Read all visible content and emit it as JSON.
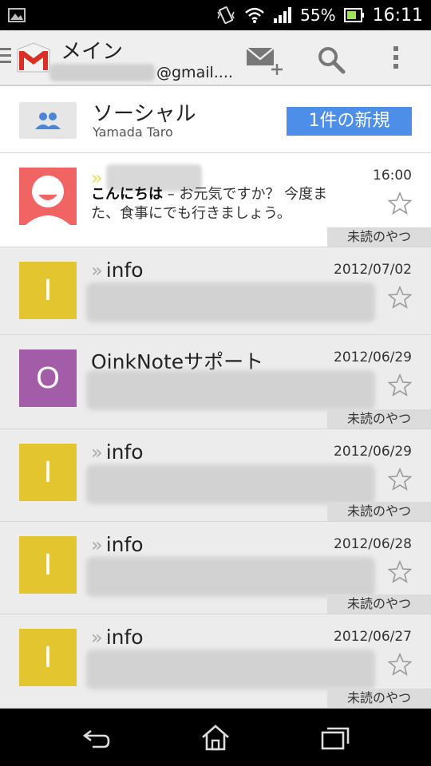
{
  "status_bar": {
    "battery_pct": "55%",
    "clock": "16:11",
    "icons": [
      "image-icon",
      "vibrate-icon",
      "wifi-icon",
      "signal-icon",
      "battery-icon"
    ]
  },
  "action_bar": {
    "title": "メイン",
    "account_suffix": "@gmail....",
    "icons": [
      "menu-icon",
      "gmail-logo",
      "compose-icon",
      "search-icon",
      "overflow-icon"
    ]
  },
  "social": {
    "title": "ソーシャル",
    "subtitle": "Yamada Taro",
    "badge": "1件の新規",
    "icon": "people-icon"
  },
  "emails": [
    {
      "avatar_letter": "",
      "avatar_color": "#f06464",
      "avatar_icon": "person-icon",
      "sender": "",
      "date": "16:00",
      "subject": "こんにちは",
      "snippet": " – お元気ですか？ 今度また、食事にでも行きましょう。",
      "label": "未読のやつ",
      "important": true
    },
    {
      "avatar_letter": "I",
      "avatar_color": "#e3c52f",
      "sender": "info",
      "date": "2012/07/02",
      "label": "",
      "important": false
    },
    {
      "avatar_letter": "O",
      "avatar_color": "#a35ca8",
      "sender": "OinkNoteサポート",
      "date": "2012/06/29",
      "label": "未読のやつ",
      "important": false
    },
    {
      "avatar_letter": "I",
      "avatar_color": "#e3c52f",
      "sender": "info",
      "date": "2012/06/29",
      "label": "未読のやつ",
      "important": false
    },
    {
      "avatar_letter": "I",
      "avatar_color": "#e3c52f",
      "sender": "info",
      "date": "2012/06/28",
      "label": "未読のやつ",
      "important": false
    },
    {
      "avatar_letter": "I",
      "avatar_color": "#e3c52f",
      "sender": "info",
      "date": "2012/06/27",
      "label": "未読のやつ",
      "important": false
    }
  ],
  "nav_bar": {
    "icons": [
      "back-icon",
      "home-icon",
      "recent-apps-icon"
    ]
  }
}
